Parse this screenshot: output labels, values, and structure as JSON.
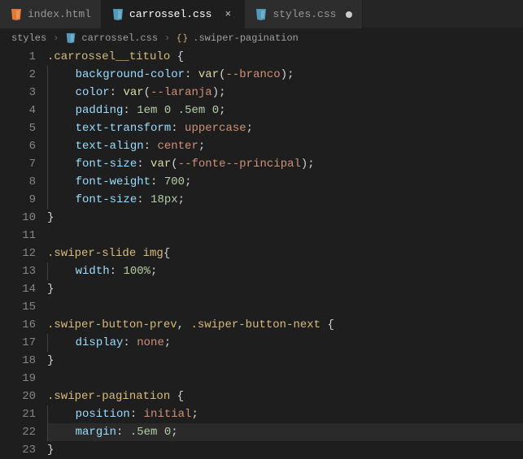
{
  "tabs": [
    {
      "label": "index.html",
      "icon": "html"
    },
    {
      "label": "carrossel.css",
      "icon": "css",
      "active": true,
      "dirty": false
    },
    {
      "label": "styles.css",
      "icon": "css",
      "dirty": true
    }
  ],
  "breadcrumbs": [
    {
      "label": "styles",
      "icon": ""
    },
    {
      "label": "carrossel.css",
      "icon": "css"
    },
    {
      "label": ".swiper-pagination",
      "icon": "brace"
    }
  ],
  "currentLine": 22,
  "code": [
    {
      "n": 1,
      "t": [
        [
          "sel",
          ".carrossel__titulo "
        ],
        [
          "punc",
          "{"
        ]
      ]
    },
    {
      "n": 2,
      "t": [
        [
          "prop",
          "background-color"
        ],
        [
          "punc",
          ": "
        ],
        [
          "func",
          "var"
        ],
        [
          "punc",
          "("
        ],
        [
          "val",
          "--branco"
        ],
        [
          "punc",
          ");"
        ]
      ],
      "indent": 1
    },
    {
      "n": 3,
      "t": [
        [
          "prop",
          "color"
        ],
        [
          "punc",
          ": "
        ],
        [
          "func",
          "var"
        ],
        [
          "punc",
          "("
        ],
        [
          "val",
          "--laranja"
        ],
        [
          "punc",
          ");"
        ]
      ],
      "indent": 1
    },
    {
      "n": 4,
      "t": [
        [
          "prop",
          "padding"
        ],
        [
          "punc",
          ": "
        ],
        [
          "num",
          "1em"
        ],
        [
          "punc",
          " "
        ],
        [
          "num",
          "0"
        ],
        [
          "punc",
          " "
        ],
        [
          "num",
          ".5em"
        ],
        [
          "punc",
          " "
        ],
        [
          "num",
          "0"
        ],
        [
          "punc",
          ";"
        ]
      ],
      "indent": 1
    },
    {
      "n": 5,
      "t": [
        [
          "prop",
          "text-transform"
        ],
        [
          "punc",
          ": "
        ],
        [
          "kw",
          "uppercase"
        ],
        [
          "punc",
          ";"
        ]
      ],
      "indent": 1
    },
    {
      "n": 6,
      "t": [
        [
          "prop",
          "text-align"
        ],
        [
          "punc",
          ": "
        ],
        [
          "kw",
          "center"
        ],
        [
          "punc",
          ";"
        ]
      ],
      "indent": 1
    },
    {
      "n": 7,
      "t": [
        [
          "prop",
          "font-size"
        ],
        [
          "punc",
          ": "
        ],
        [
          "func",
          "var"
        ],
        [
          "punc",
          "("
        ],
        [
          "val",
          "--fonte--principal"
        ],
        [
          "punc",
          ");"
        ]
      ],
      "indent": 1
    },
    {
      "n": 8,
      "t": [
        [
          "prop",
          "font-weight"
        ],
        [
          "punc",
          ": "
        ],
        [
          "num",
          "700"
        ],
        [
          "punc",
          ";"
        ]
      ],
      "indent": 1
    },
    {
      "n": 9,
      "t": [
        [
          "prop",
          "font-size"
        ],
        [
          "punc",
          ": "
        ],
        [
          "num",
          "18px"
        ],
        [
          "punc",
          ";"
        ]
      ],
      "indent": 1
    },
    {
      "n": 10,
      "t": [
        [
          "punc",
          "}"
        ]
      ]
    },
    {
      "n": 11,
      "t": []
    },
    {
      "n": 12,
      "t": [
        [
          "sel",
          ".swiper-slide "
        ],
        [
          "sel",
          "img"
        ],
        [
          "punc",
          "{"
        ]
      ]
    },
    {
      "n": 13,
      "t": [
        [
          "prop",
          "width"
        ],
        [
          "punc",
          ": "
        ],
        [
          "num",
          "100%"
        ],
        [
          "punc",
          ";"
        ]
      ],
      "indent": 1
    },
    {
      "n": 14,
      "t": [
        [
          "punc",
          "}"
        ]
      ]
    },
    {
      "n": 15,
      "t": []
    },
    {
      "n": 16,
      "t": [
        [
          "sel",
          ".swiper-button-prev"
        ],
        [
          "punc",
          ", "
        ],
        [
          "sel",
          ".swiper-button-next "
        ],
        [
          "punc",
          "{"
        ]
      ]
    },
    {
      "n": 17,
      "t": [
        [
          "prop",
          "display"
        ],
        [
          "punc",
          ": "
        ],
        [
          "kw",
          "none"
        ],
        [
          "punc",
          ";"
        ]
      ],
      "indent": 1
    },
    {
      "n": 18,
      "t": [
        [
          "punc",
          "}"
        ]
      ]
    },
    {
      "n": 19,
      "t": []
    },
    {
      "n": 20,
      "t": [
        [
          "sel",
          ".swiper-pagination "
        ],
        [
          "punc",
          "{"
        ]
      ]
    },
    {
      "n": 21,
      "t": [
        [
          "prop",
          "position"
        ],
        [
          "punc",
          ": "
        ],
        [
          "kw",
          "initial"
        ],
        [
          "punc",
          ";"
        ]
      ],
      "indent": 1
    },
    {
      "n": 22,
      "t": [
        [
          "prop",
          "margin"
        ],
        [
          "punc",
          ": "
        ],
        [
          "num",
          ".5em"
        ],
        [
          "punc",
          " "
        ],
        [
          "num",
          "0"
        ],
        [
          "punc",
          ";"
        ]
      ],
      "indent": 1
    },
    {
      "n": 23,
      "t": [
        [
          "punc",
          "}"
        ]
      ]
    }
  ]
}
